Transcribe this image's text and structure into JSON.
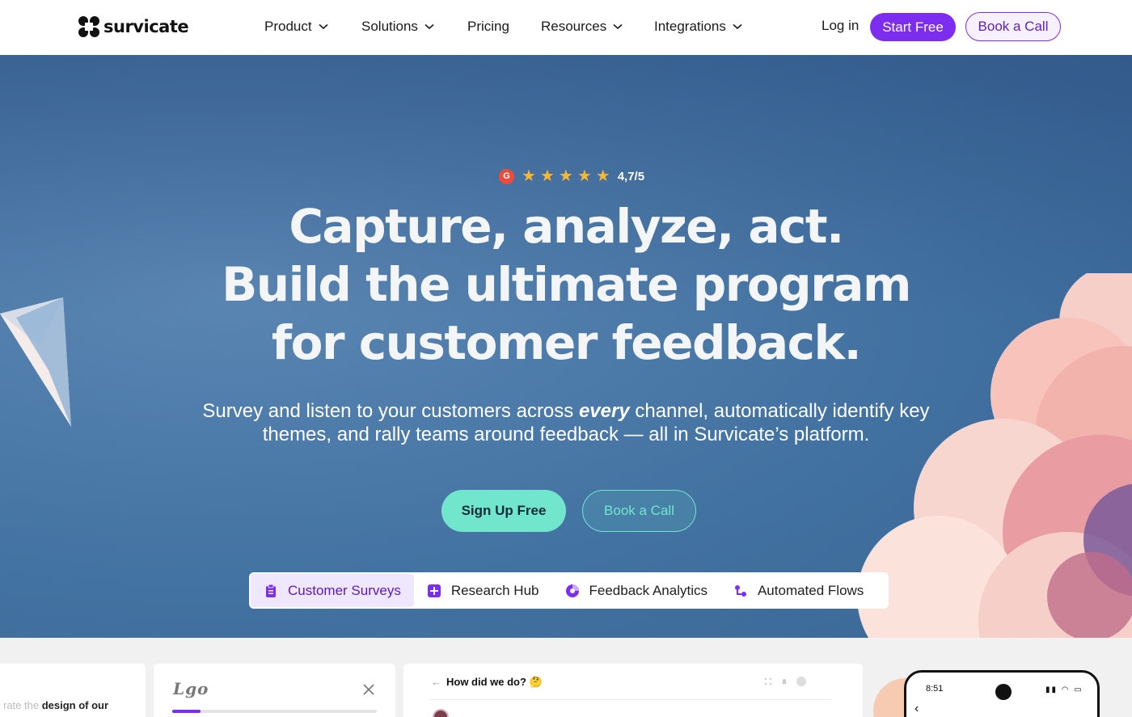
{
  "brand": {
    "name": "survicate"
  },
  "nav": {
    "items": [
      {
        "label": "Product",
        "has_dropdown": true
      },
      {
        "label": "Solutions",
        "has_dropdown": true
      },
      {
        "label": "Pricing",
        "has_dropdown": false
      },
      {
        "label": "Resources",
        "has_dropdown": true
      },
      {
        "label": "Integrations",
        "has_dropdown": true
      }
    ],
    "login_label": "Log in",
    "start_free_label": "Start Free",
    "book_call_label": "Book a Call"
  },
  "hero": {
    "rating": {
      "source_icon": "g2-icon",
      "stars": 5,
      "value_text": "4,7/5"
    },
    "headline": [
      "Capture, analyze, act.",
      "Build the ultimate program",
      "for customer feedback."
    ],
    "subtitle": {
      "before": "Survey and listen to your customers across ",
      "emphasis": "every",
      "after": " channel, automatically identify key themes, and rally teams around feedback — all in Survicate’s platform."
    },
    "signup_label": "Sign Up Free",
    "book_call_label": "Book a Call",
    "tabs": [
      {
        "label": "Customer Surveys",
        "icon": "clipboard-icon",
        "active": true
      },
      {
        "label": "Research Hub",
        "icon": "sparkle-plus-icon",
        "active": false
      },
      {
        "label": "Feedback Analytics",
        "icon": "pie-chart-icon",
        "active": false
      },
      {
        "label": "Automated Flows",
        "icon": "flow-icon",
        "active": false
      }
    ]
  },
  "preview": {
    "card1_faded": "rate the",
    "card1_text": " design of our",
    "card2_logo": "Lgo",
    "card2_progress_fraction": 0.14,
    "card3_back": "←",
    "card3_title": "How did we do? 🤔",
    "phone_time": "8:51"
  },
  "colors": {
    "primary_purple": "#7c2df0",
    "mint": "#72e6cc",
    "hero_blue": "#4b79a8",
    "star": "#f7b731",
    "g2_red": "#ef4b3a"
  }
}
